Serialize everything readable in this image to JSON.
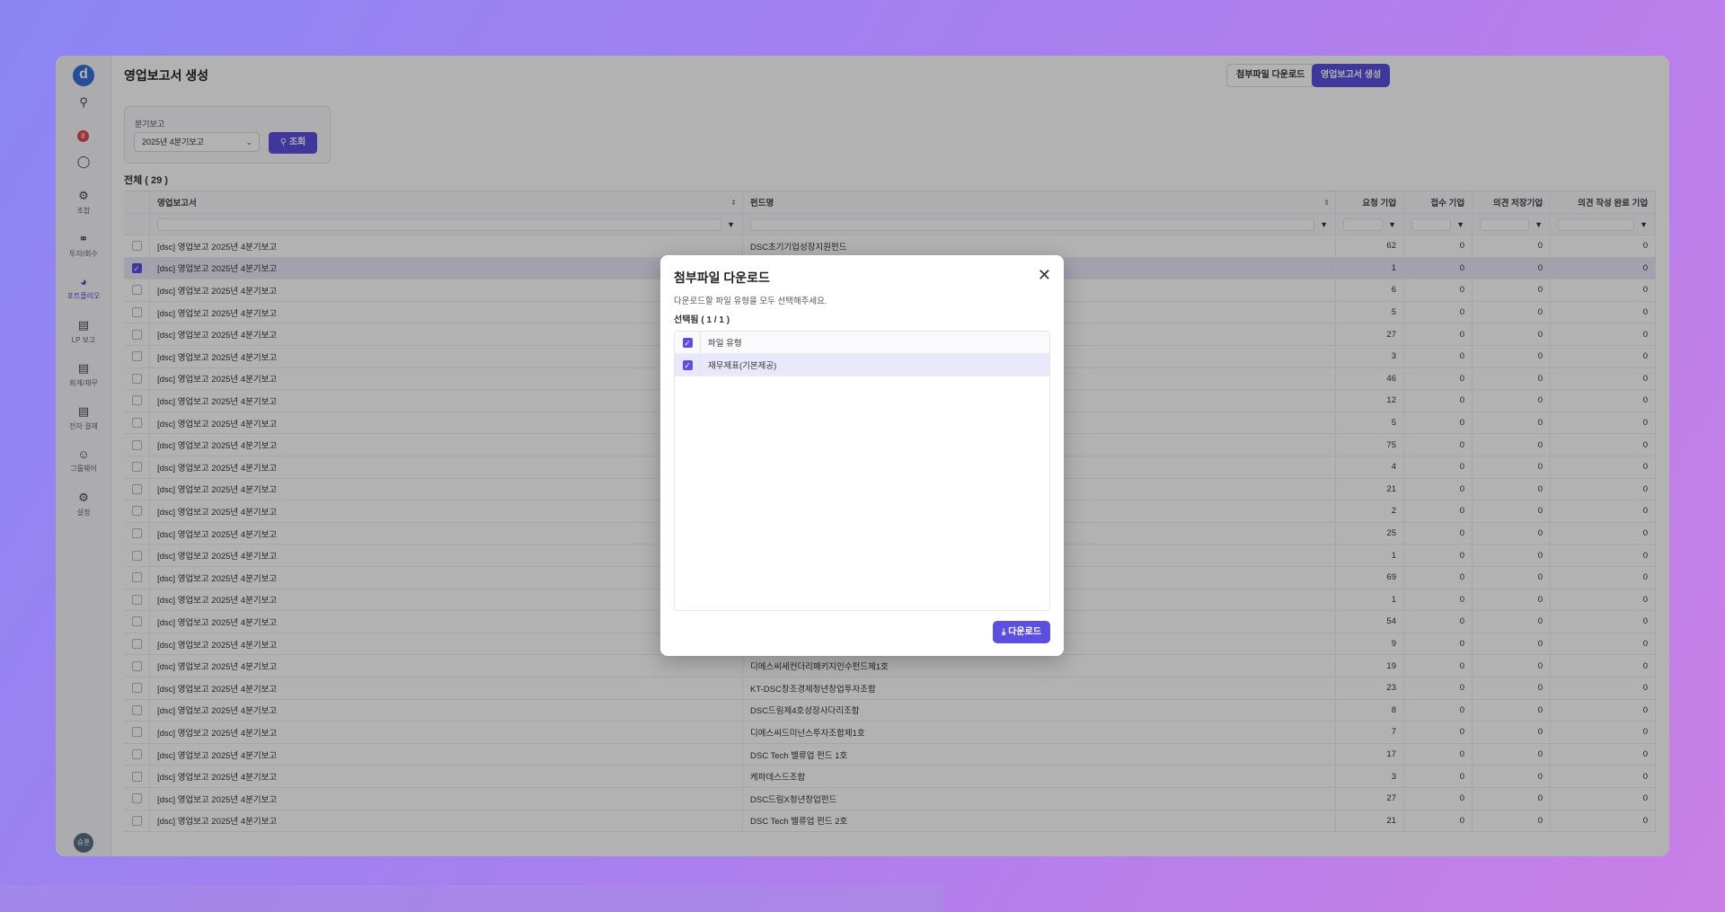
{
  "sidebar": {
    "logo": "d",
    "badge": "8",
    "items": [
      {
        "icon": "cluster-icon",
        "label": "조합"
      },
      {
        "icon": "invest-icon",
        "label": "투자/회수"
      },
      {
        "icon": "portfolio-icon",
        "label": "포트폴리오"
      },
      {
        "icon": "lp-report-icon",
        "label": "LP 보고"
      },
      {
        "icon": "accounting-icon",
        "label": "회계/재무"
      },
      {
        "icon": "approval-icon",
        "label": "전자 결재"
      },
      {
        "icon": "groupware-icon",
        "label": "그룹웨어"
      },
      {
        "icon": "settings-icon",
        "label": "설정"
      }
    ],
    "avatar": "승훈"
  },
  "header": {
    "title": "영업보고서 생성",
    "download_btn": "첨부파일 다운로드",
    "create_btn": "영업보고서 생성"
  },
  "filter": {
    "label": "분기보고",
    "selected": "2025년 4분기보고",
    "search_btn": "조회"
  },
  "total_label": "전체 ( 29 )",
  "columns": [
    "영업보고서",
    "펀드명",
    "요청 기업",
    "접수 기업",
    "의견 저장기업",
    "의견 작성 완료 기업"
  ],
  "rows": [
    {
      "report": "[dsc] 영업보고 2025년 4분기보고",
      "fund": "DSC초기기업성장지원펀드",
      "req": "62",
      "recv": "0",
      "saved": "0",
      "done": "0",
      "checked": false
    },
    {
      "report": "[dsc] 영업보고 2025년 4분기보고",
      "fund": "",
      "req": "1",
      "recv": "0",
      "saved": "0",
      "done": "0",
      "checked": true
    },
    {
      "report": "[dsc] 영업보고 2025년 4분기보고",
      "fund": "",
      "req": "6",
      "recv": "0",
      "saved": "0",
      "done": "0",
      "checked": false
    },
    {
      "report": "[dsc] 영업보고 2025년 4분기보고",
      "fund": "",
      "req": "5",
      "recv": "0",
      "saved": "0",
      "done": "0",
      "checked": false
    },
    {
      "report": "[dsc] 영업보고 2025년 4분기보고",
      "fund": "",
      "req": "27",
      "recv": "0",
      "saved": "0",
      "done": "0",
      "checked": false
    },
    {
      "report": "[dsc] 영업보고 2025년 4분기보고",
      "fund": "",
      "req": "3",
      "recv": "0",
      "saved": "0",
      "done": "0",
      "checked": false
    },
    {
      "report": "[dsc] 영업보고 2025년 4분기보고",
      "fund": "",
      "req": "46",
      "recv": "0",
      "saved": "0",
      "done": "0",
      "checked": false
    },
    {
      "report": "[dsc] 영업보고 2025년 4분기보고",
      "fund": "",
      "req": "12",
      "recv": "0",
      "saved": "0",
      "done": "0",
      "checked": false
    },
    {
      "report": "[dsc] 영업보고 2025년 4분기보고",
      "fund": "",
      "req": "5",
      "recv": "0",
      "saved": "0",
      "done": "0",
      "checked": false
    },
    {
      "report": "[dsc] 영업보고 2025년 4분기보고",
      "fund": "",
      "req": "75",
      "recv": "0",
      "saved": "0",
      "done": "0",
      "checked": false
    },
    {
      "report": "[dsc] 영업보고 2025년 4분기보고",
      "fund": "",
      "req": "4",
      "recv": "0",
      "saved": "0",
      "done": "0",
      "checked": false
    },
    {
      "report": "[dsc] 영업보고 2025년 4분기보고",
      "fund": "",
      "req": "21",
      "recv": "0",
      "saved": "0",
      "done": "0",
      "checked": false
    },
    {
      "report": "[dsc] 영업보고 2025년 4분기보고",
      "fund": "",
      "req": "2",
      "recv": "0",
      "saved": "0",
      "done": "0",
      "checked": false
    },
    {
      "report": "[dsc] 영업보고 2025년 4분기보고",
      "fund": "",
      "req": "25",
      "recv": "0",
      "saved": "0",
      "done": "0",
      "checked": false
    },
    {
      "report": "[dsc] 영업보고 2025년 4분기보고",
      "fund": "",
      "req": "1",
      "recv": "0",
      "saved": "0",
      "done": "0",
      "checked": false
    },
    {
      "report": "[dsc] 영업보고 2025년 4분기보고",
      "fund": "",
      "req": "69",
      "recv": "0",
      "saved": "0",
      "done": "0",
      "checked": false
    },
    {
      "report": "[dsc] 영업보고 2025년 4분기보고",
      "fund": "",
      "req": "1",
      "recv": "0",
      "saved": "0",
      "done": "0",
      "checked": false
    },
    {
      "report": "[dsc] 영업보고 2025년 4분기보고",
      "fund": "",
      "req": "54",
      "recv": "0",
      "saved": "0",
      "done": "0",
      "checked": false
    },
    {
      "report": "[dsc] 영업보고 2025년 4분기보고",
      "fund": "",
      "req": "9",
      "recv": "0",
      "saved": "0",
      "done": "0",
      "checked": false
    },
    {
      "report": "[dsc] 영업보고 2025년 4분기보고",
      "fund": "디에스씨세컨더리패키지인수펀드제1호",
      "req": "19",
      "recv": "0",
      "saved": "0",
      "done": "0",
      "checked": false
    },
    {
      "report": "[dsc] 영업보고 2025년 4분기보고",
      "fund": "KT-DSC창조경제청년창업투자조합",
      "req": "23",
      "recv": "0",
      "saved": "0",
      "done": "0",
      "checked": false
    },
    {
      "report": "[dsc] 영업보고 2025년 4분기보고",
      "fund": "DSC드림제4호성장사다리조합",
      "req": "8",
      "recv": "0",
      "saved": "0",
      "done": "0",
      "checked": false
    },
    {
      "report": "[dsc] 영업보고 2025년 4분기보고",
      "fund": "디에스씨드미넌스투자조합제1호",
      "req": "7",
      "recv": "0",
      "saved": "0",
      "done": "0",
      "checked": false
    },
    {
      "report": "[dsc] 영업보고 2025년 4분기보고",
      "fund": "DSC Tech 밸류업 펀드 1호",
      "req": "17",
      "recv": "0",
      "saved": "0",
      "done": "0",
      "checked": false
    },
    {
      "report": "[dsc] 영업보고 2025년 4분기보고",
      "fund": "케파데스드조합",
      "req": "3",
      "recv": "0",
      "saved": "0",
      "done": "0",
      "checked": false
    },
    {
      "report": "[dsc] 영업보고 2025년 4분기보고",
      "fund": "DSC드림X청년창업펀드",
      "req": "27",
      "recv": "0",
      "saved": "0",
      "done": "0",
      "checked": false
    },
    {
      "report": "[dsc] 영업보고 2025년 4분기보고",
      "fund": "DSC Tech 밸류업 펀드 2호",
      "req": "21",
      "recv": "0",
      "saved": "0",
      "done": "0",
      "checked": false
    }
  ],
  "modal": {
    "title": "첨부파일 다운로드",
    "description": "다운로드할 파일 유형을 모두 선택해주세요.",
    "count": "선택됨 ( 1 / 1 )",
    "header": "파일 유형",
    "items": [
      "재무제표(기본제공)"
    ],
    "download_btn": "다운로드"
  }
}
